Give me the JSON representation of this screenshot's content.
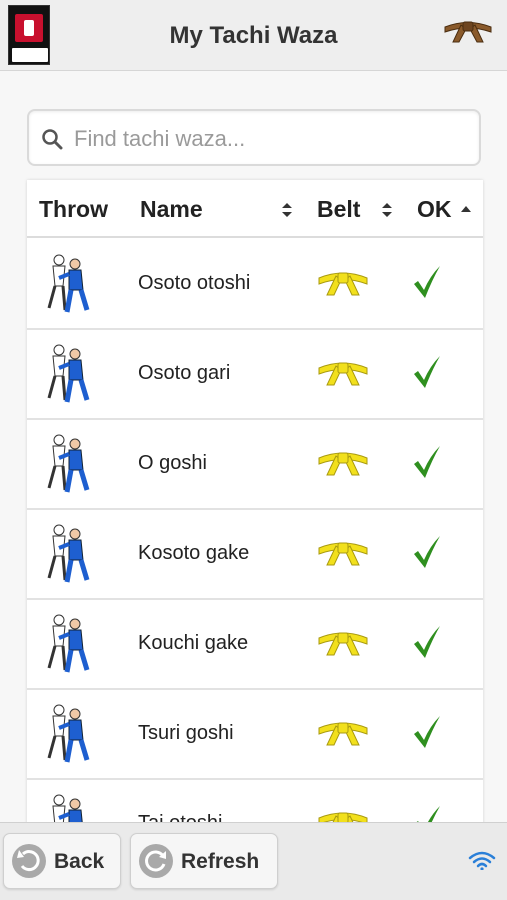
{
  "header": {
    "title": "My Tachi Waza",
    "logo_icon": "judo-club-logo-icon",
    "belt_icon": "brown-belt-icon",
    "belt_color": "#8a5a2b"
  },
  "search": {
    "placeholder": "Find tachi waza..."
  },
  "table": {
    "columns": [
      "Throw",
      "Name",
      "Belt",
      "OK"
    ],
    "sorted_column": "OK",
    "sort_direction": "ascending",
    "rows": [
      {
        "name": "Osoto otoshi",
        "belt": "yellow",
        "ok": true
      },
      {
        "name": "Osoto gari",
        "belt": "yellow",
        "ok": true
      },
      {
        "name": "O goshi",
        "belt": "yellow",
        "ok": true
      },
      {
        "name": "Kosoto gake",
        "belt": "yellow",
        "ok": true
      },
      {
        "name": "Kouchi gake",
        "belt": "yellow",
        "ok": true
      },
      {
        "name": "Tsuri goshi",
        "belt": "yellow",
        "ok": true
      },
      {
        "name": "Tai otoshi",
        "belt": "yellow",
        "ok": true
      }
    ]
  },
  "footer": {
    "back_label": "Back",
    "refresh_label": "Refresh",
    "status_icon": "wifi-icon"
  },
  "colors": {
    "belt_yellow": "#f2e01c",
    "check_green": "#2f8f1f",
    "tori_blue": "#1e5fd0"
  }
}
